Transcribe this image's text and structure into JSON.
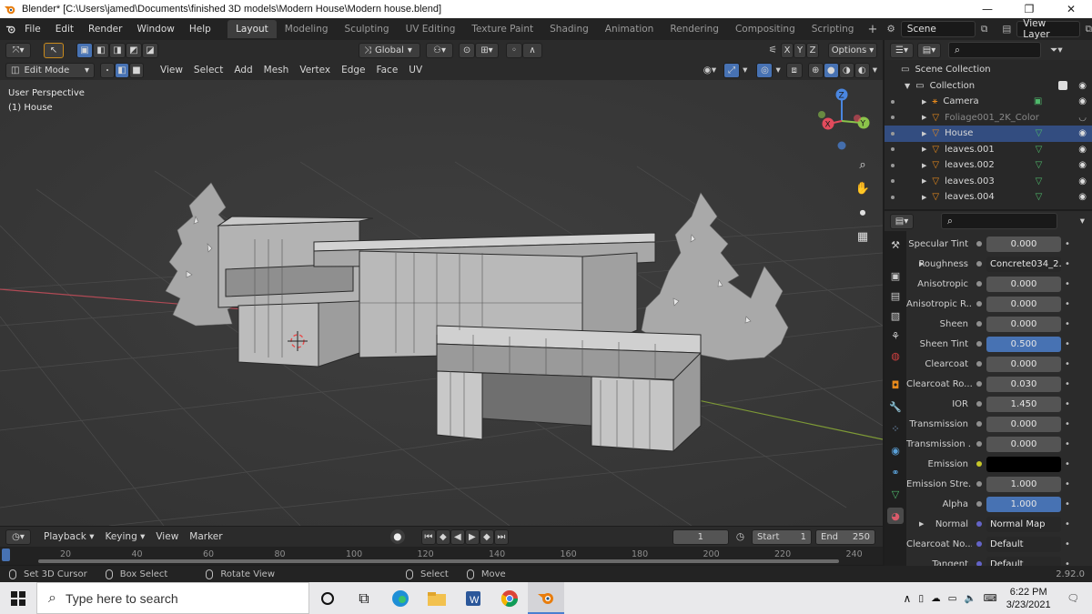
{
  "titlebar": {
    "title": "Blender* [C:\\Users\\jamed\\Documents\\finished 3D models\\Modern House\\Modern house.blend]",
    "minimize": "—",
    "maximize": "❐",
    "close": "✕"
  },
  "menus": [
    "File",
    "Edit",
    "Render",
    "Window",
    "Help"
  ],
  "workspaces": [
    "Layout",
    "Modeling",
    "Sculpting",
    "UV Editing",
    "Texture Paint",
    "Shading",
    "Animation",
    "Rendering",
    "Compositing",
    "Scripting"
  ],
  "active_workspace": "Layout",
  "scene": {
    "name": "Scene",
    "view_layer": "View Layer"
  },
  "toolbar": {
    "transform_orientation": "Global",
    "axes": [
      "X",
      "Y",
      "Z"
    ],
    "options": "Options"
  },
  "viewport_header": {
    "mode": "Edit Mode",
    "menus": [
      "View",
      "Select",
      "Add",
      "Mesh",
      "Vertex",
      "Edge",
      "Face",
      "UV"
    ]
  },
  "viewport": {
    "perspective_label": "User Perspective",
    "object_label": "(1) House",
    "gizmo": {
      "x": "X",
      "y": "Y",
      "z": "Z"
    }
  },
  "outliner": {
    "root": "Scene Collection",
    "collection": "Collection",
    "items": [
      {
        "name": "Camera",
        "selected": false,
        "dim": false
      },
      {
        "name": "Foliage001_2K_Color",
        "selected": false,
        "dim": true
      },
      {
        "name": "House",
        "selected": true,
        "dim": false
      },
      {
        "name": "leaves.001",
        "selected": false,
        "dim": false
      },
      {
        "name": "leaves.002",
        "selected": false,
        "dim": false
      },
      {
        "name": "leaves.003",
        "selected": false,
        "dim": false
      },
      {
        "name": "leaves.004",
        "selected": false,
        "dim": false
      }
    ]
  },
  "properties": {
    "rows": [
      {
        "label": "Specular Tint",
        "value": "0.000",
        "style": "normal",
        "dot": true
      },
      {
        "label": "Roughness",
        "value": "Concrete034_2...",
        "style": "dark",
        "dot": true,
        "expand": true
      },
      {
        "label": "Anisotropic",
        "value": "0.000",
        "style": "normal",
        "dot": true
      },
      {
        "label": "Anisotropic R...",
        "value": "0.000",
        "style": "normal",
        "dot": true
      },
      {
        "label": "Sheen",
        "value": "0.000",
        "style": "normal",
        "dot": true
      },
      {
        "label": "Sheen Tint",
        "value": "0.500",
        "style": "blue",
        "dot": true
      },
      {
        "label": "Clearcoat",
        "value": "0.000",
        "style": "normal",
        "dot": true
      },
      {
        "label": "Clearcoat Ro...",
        "value": "0.030",
        "style": "normal",
        "dot": true
      },
      {
        "label": "IOR",
        "value": "1.450",
        "style": "normal",
        "dot": true
      },
      {
        "label": "Transmission",
        "value": "0.000",
        "style": "normal",
        "dot": true
      },
      {
        "label": "Transmission ...",
        "value": "0.000",
        "style": "normal",
        "dot": true
      },
      {
        "label": "Emission",
        "value": "",
        "style": "black",
        "dot": true,
        "dot_color": "#c7c729"
      },
      {
        "label": "Emission Stre...",
        "value": "1.000",
        "style": "normal",
        "dot": true
      },
      {
        "label": "Alpha",
        "value": "1.000",
        "style": "blue",
        "dot": true
      },
      {
        "label": "Normal",
        "value": "Normal Map",
        "style": "dark",
        "dot": true,
        "expand": true,
        "dot_color": "#6363c7"
      },
      {
        "label": "Clearcoat No...",
        "value": "Default",
        "style": "dark",
        "dot": true,
        "dot_color": "#6363c7"
      },
      {
        "label": "Tangent",
        "value": "Default",
        "style": "dark",
        "dot": true,
        "dot_color": "#6363c7"
      }
    ]
  },
  "timeline": {
    "menus": [
      "Playback",
      "Keying",
      "View",
      "Marker"
    ],
    "current_frame": "1",
    "start_label": "Start",
    "start": "1",
    "end_label": "End",
    "end": "250",
    "ruler": [
      "20",
      "40",
      "60",
      "80",
      "100",
      "120",
      "140",
      "160",
      "180",
      "200",
      "220",
      "240"
    ]
  },
  "statusbar": {
    "items": [
      "Set 3D Cursor",
      "Box Select",
      "Rotate View",
      "Select",
      "Move"
    ],
    "version": "2.92.0"
  },
  "taskbar": {
    "search_placeholder": "Type here to search",
    "time": "6:22 PM",
    "date": "3/23/2021"
  },
  "colors": {
    "accent_blue": "#4772b3",
    "selected_row": "#334d80",
    "viewport_bg": "#3a3a3a",
    "axis_red": "#e24b5c",
    "axis_green": "#8bc34a",
    "axis_blue": "#4a86e0"
  }
}
